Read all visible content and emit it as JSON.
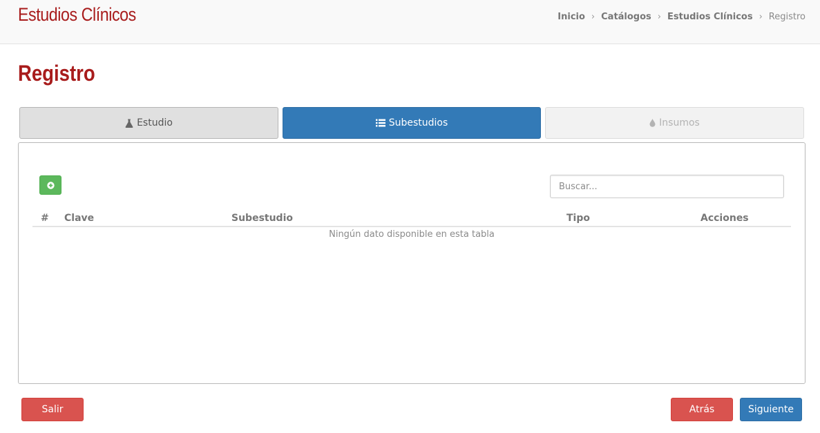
{
  "header": {
    "app_title": "Estudios Clínicos",
    "breadcrumb": [
      "Inicio",
      "Catálogos",
      "Estudios Clínicos",
      "Registro"
    ]
  },
  "page": {
    "title": "Registro"
  },
  "tabs": [
    {
      "label": "Estudio",
      "icon": "flask-icon",
      "state": "default"
    },
    {
      "label": "Subestudios",
      "icon": "list-icon",
      "state": "active"
    },
    {
      "label": "Insumos",
      "icon": "drop-icon",
      "state": "disabled"
    }
  ],
  "toolbar": {
    "add_icon": "plus-circle-icon",
    "search_placeholder": "Buscar..."
  },
  "table": {
    "columns": [
      "#",
      "Clave",
      "Subestudio",
      "Tipo",
      "Acciones"
    ],
    "rows": [],
    "empty_message": "Ningún dato disponible en esta tabla"
  },
  "footer": {
    "exit_label": "Salir",
    "back_label": "Atrás",
    "next_label": "Siguiente"
  },
  "colors": {
    "brand": "#a81c1c",
    "primary": "#337ab7",
    "success": "#5cb85c",
    "danger": "#d9534f"
  }
}
